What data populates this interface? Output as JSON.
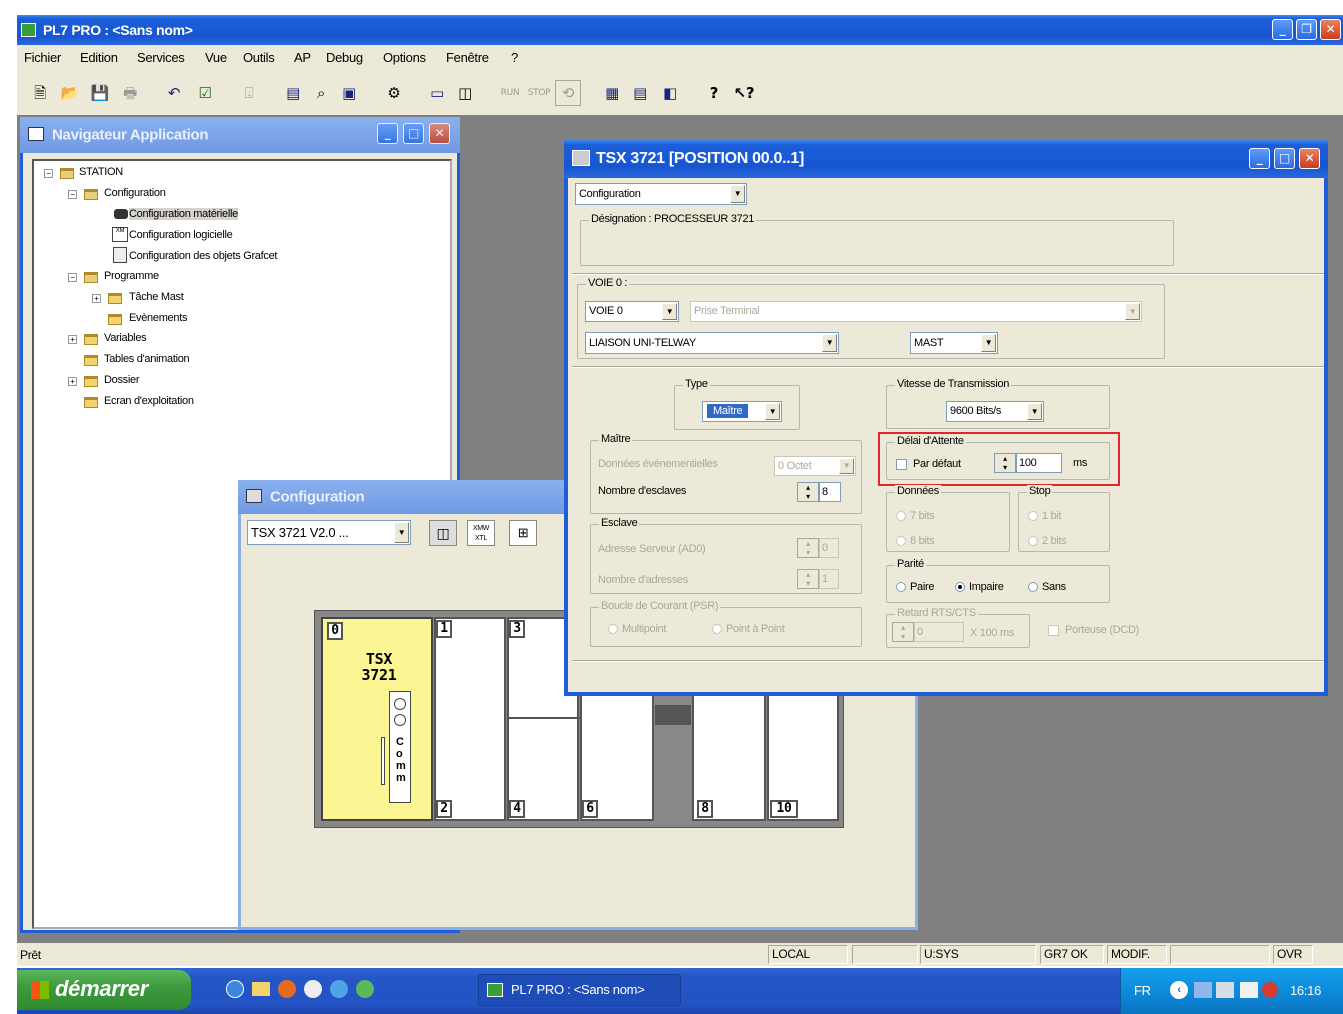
{
  "app": {
    "title": "PL7 PRO : <Sans nom>",
    "menu": [
      "Fichier",
      "Edition",
      "Services",
      "Vue",
      "Outils",
      "AP",
      "Debug",
      "Options",
      "Fenêtre",
      "?"
    ],
    "toolbar_icons": [
      "new-icon",
      "open-icon",
      "save-icon",
      "print-icon",
      "undo-icon",
      "validate-icon",
      "export-icon",
      "window-icon",
      "find-icon",
      "replace-icon",
      "config-icon",
      "memory-icon",
      "connect-icon",
      "run-icon",
      "stop-icon",
      "init-icon",
      "list-icon",
      "tile-icon",
      "split-icon",
      "help-icon",
      "context-help-icon"
    ]
  },
  "navigator": {
    "title": "Navigateur Application",
    "tree": {
      "station": "STATION",
      "configuration": "Configuration",
      "config_materielle": "Configuration matérielle",
      "config_logicielle": "Configuration logicielle",
      "config_grafcet": "Configuration des objets Grafcet",
      "programme": "Programme",
      "tache_mast": "Tâche Mast",
      "evenements": "Evènements",
      "variables": "Variables",
      "tables_animation": "Tables d'animation",
      "dossier": "Dossier",
      "ecran": "Ecran d'exploitation"
    }
  },
  "config_window": {
    "title": "Configuration",
    "processor_select": "TSX 3721  V2.0 ...",
    "rack": {
      "module_name": "TSX 3721",
      "comm_label": "C o m m",
      "slots": [
        "0",
        "1",
        "2",
        "3",
        "4",
        "6",
        "8",
        "10"
      ]
    }
  },
  "dialog": {
    "title": "TSX 3721 [POSITION 00.0..1]",
    "view_select": "Configuration",
    "designation": "Désignation : PROCESSEUR 3721",
    "voie_group": "VOIE 0 :",
    "voie_select": "VOIE 0",
    "prise_terminal": "Prise Terminal",
    "liaison_select": "LIAISON UNI-TELWAY",
    "task_select": "MAST",
    "type": {
      "label": "Type",
      "value": "Maître"
    },
    "vitesse": {
      "label": "Vitesse de Transmission",
      "value": "9600 Bits/s"
    },
    "maitre": {
      "label": "Maître",
      "donnees_evt": "Données événementielles",
      "donnees_evt_value": "0 Octet",
      "nb_esclaves": "Nombre d'esclaves",
      "nb_esclaves_value": "8"
    },
    "delai": {
      "label": "Délai d'Attente",
      "par_defaut": "Par défaut",
      "value": "100",
      "unit": "ms"
    },
    "donnees": {
      "label": "Données",
      "opt1": "7 bits",
      "opt2": "8 bits"
    },
    "stop": {
      "label": "Stop",
      "opt1": "1 bit",
      "opt2": "2 bits"
    },
    "esclave": {
      "label": "Esclave",
      "adresse_serveur": "Adresse Serveur (AD0)",
      "adresse_serveur_value": "0",
      "nb_adresses": "Nombre d'adresses",
      "nb_adresses_value": "1"
    },
    "parite": {
      "label": "Parité",
      "paire": "Paire",
      "impaire": "Impaire",
      "sans": "Sans"
    },
    "boucle": {
      "label": "Boucle de Courant (PSR)",
      "multipoint": "Multipoint",
      "point": "Point à Point"
    },
    "retard": {
      "label": "Retard RTS/CTS",
      "value": "0",
      "unit": "X 100 ms",
      "porteuse": "Porteuse (DCD)"
    },
    "highlight_color": "#e0262a"
  },
  "statusbar": {
    "ready": "Prêt",
    "local": "LOCAL",
    "usys": "U:SYS",
    "gr7": "GR7 OK",
    "modif": "MODIF.",
    "ovr": "OVR"
  },
  "taskbar": {
    "start": "démarrer",
    "task": "PL7 PRO : <Sans nom>",
    "lang": "FR",
    "clock": "16:16"
  }
}
